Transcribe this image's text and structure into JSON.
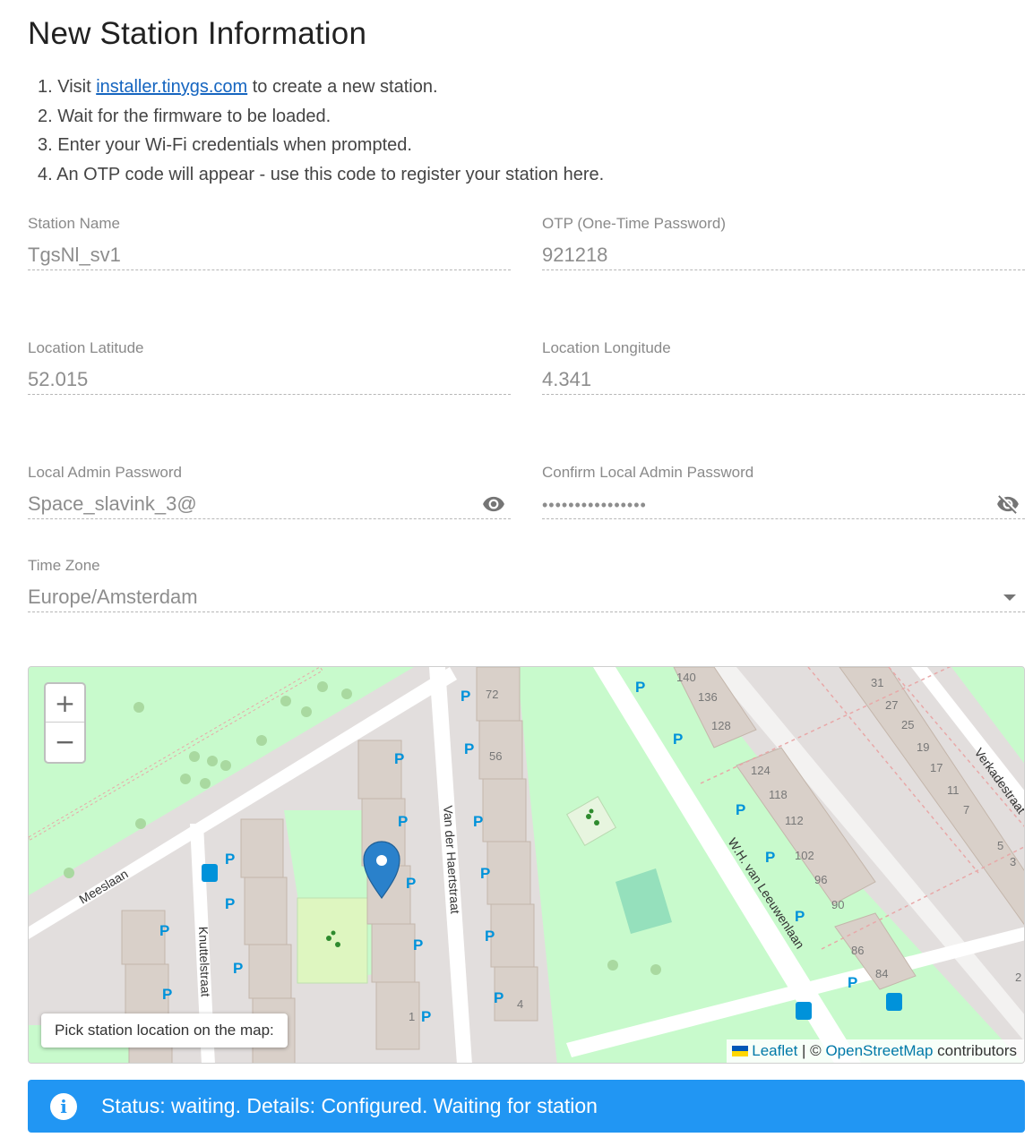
{
  "title": "New Station Information",
  "steps": {
    "s1_prefix": "1. Visit ",
    "s1_link": "installer.tinygs.com",
    "s1_suffix": " to create a new station.",
    "s2": "2. Wait for the firmware to be loaded.",
    "s3": "3. Enter your Wi-Fi credentials when prompted.",
    "s4": "4. An OTP code will appear - use this code to register your station here."
  },
  "form": {
    "station_name": {
      "label": "Station Name",
      "value": "TgsNl_sv1"
    },
    "otp": {
      "label": "OTP (One-Time Password)",
      "value": "921218"
    },
    "latitude": {
      "label": "Location Latitude",
      "value": "52.015"
    },
    "longitude": {
      "label": "Location Longitude",
      "value": "4.341"
    },
    "admin_password": {
      "label": "Local Admin Password",
      "value": "Space_slavink_3@",
      "visibility_icon": "eye-icon"
    },
    "confirm_password": {
      "label": "Confirm Local Admin Password",
      "value": "••••••••••••••••",
      "visibility_icon": "eye-off-icon"
    },
    "time_zone": {
      "label": "Time Zone",
      "value": "Europe/Amsterdam"
    }
  },
  "map": {
    "zoom_in": "+",
    "zoom_out": "−",
    "hint": "Pick station location on the map:",
    "attribution": {
      "leaflet": "Leaflet",
      "sep": " | © ",
      "osm": "OpenStreetMap",
      "suffix": " contributors"
    },
    "streets": {
      "meeslaan": "Meeslaan",
      "knuttelstraat": "Knuttelstraat",
      "haertstraat": "Van der Haertstraat",
      "leeuwenlaan": "W.H. van Leeuwenlaan",
      "verkadestraat": "Verkadestraat"
    },
    "house_numbers": [
      "72",
      "56",
      "4",
      "1",
      "140",
      "136",
      "128",
      "124",
      "118",
      "112",
      "102",
      "96",
      "90",
      "86",
      "84",
      "31",
      "27",
      "25",
      "19",
      "17",
      "11",
      "7",
      "5",
      "3",
      "2"
    ],
    "parking_letter": "P"
  },
  "status": {
    "icon": "info-icon",
    "text": "Status: waiting. Details: Configured. Waiting for station"
  },
  "colors": {
    "status_bg": "#2196f3",
    "link": "#1565c0",
    "map_park": "#c8facc",
    "map_building": "#d9d0c9",
    "marker": "#2a81cb"
  }
}
